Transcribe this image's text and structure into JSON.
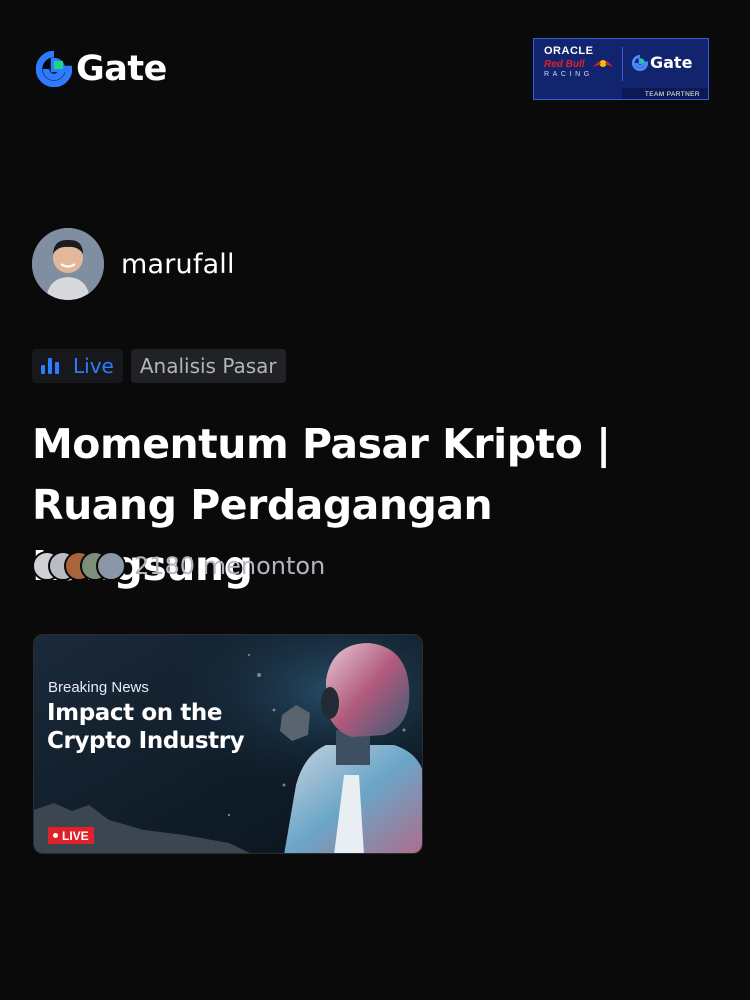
{
  "header": {
    "logo_text": "Gate",
    "logo_icon": "gate-logo-icon",
    "partner_badge": {
      "oracle": "ORACLE",
      "redbull": "Red Bull",
      "racing": "RACING",
      "gate": "Gate",
      "team_partner": "TEAM PARTNER"
    }
  },
  "author": {
    "username": "marufall",
    "avatar_icon": "user-avatar"
  },
  "tags": {
    "live": "Live",
    "category": "Analisis Pasar"
  },
  "stream": {
    "title": "Momentum Pasar Kripto | Ruang Perdagangan Langsung",
    "viewers": "2180 menonton"
  },
  "thumbnail": {
    "kicker": "Breaking News",
    "headline": "Impact on the Crypto Industry",
    "live_badge": "LIVE"
  },
  "colors": {
    "background": "#0a0a0b",
    "accent_blue": "#2f7bff",
    "gate_green": "#1ed480",
    "live_red": "#e0202a",
    "partner_navy": "#13246e"
  }
}
